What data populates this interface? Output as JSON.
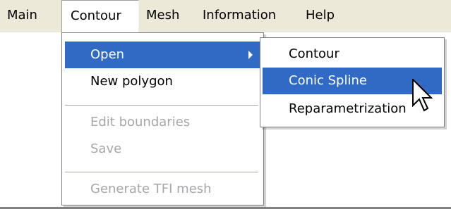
{
  "menubar": {
    "items": [
      {
        "label": "Main"
      },
      {
        "label": "Contour"
      },
      {
        "label": "Mesh"
      },
      {
        "label": "Information"
      },
      {
        "label": "Help"
      }
    ]
  },
  "contour_menu": {
    "items": [
      {
        "label": "Open",
        "state": "highlighted",
        "has_submenu": true
      },
      {
        "label": "New polygon",
        "state": "enabled"
      },
      {
        "label": "Edit boundaries",
        "state": "disabled"
      },
      {
        "label": "Save",
        "state": "disabled"
      },
      {
        "label": "Generate TFI mesh",
        "state": "disabled"
      }
    ]
  },
  "open_submenu": {
    "items": [
      {
        "label": "Contour",
        "state": "enabled"
      },
      {
        "label": "Conic Spline",
        "state": "highlighted"
      },
      {
        "label": "Reparametrization",
        "state": "enabled"
      }
    ]
  },
  "colors": {
    "menubar_bg": "#ece9d8",
    "highlight": "#316ac5",
    "disabled_text": "#a7a6aa"
  },
  "icons": {
    "submenu_arrow": "submenu-arrow-icon",
    "cursor": "mouse-cursor-icon"
  }
}
